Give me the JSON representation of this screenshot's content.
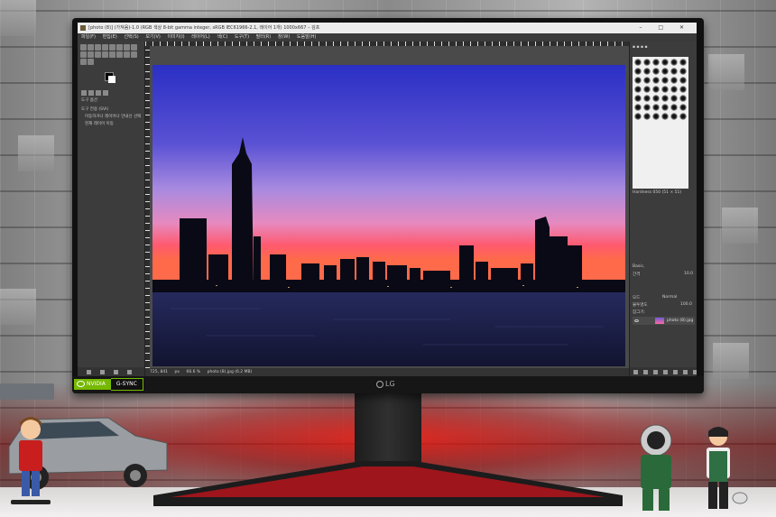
{
  "window": {
    "title": "[photo (8)] (가져옴)-1.0 (RGB 색상 8-bit gamma integer, sRGB IEC61966-2.1, 레이어 1개) 1000x667 – 김프",
    "controls": "– □ ✕"
  },
  "menubar": [
    "파일(F)",
    "편집(E)",
    "선택(S)",
    "보기(V)",
    "이미지(I)",
    "레이어(L)",
    "색(C)",
    "도구(T)",
    "필터(R)",
    "창(W)",
    "도움말(H)"
  ],
  "toolbox": {
    "tab_label": "도구 옵션",
    "group_title": "도구 전용 (SVI)",
    "option1": "이동하거나 레이어나 안내선 선택",
    "option2": "현재 레이어 이동"
  },
  "statusbar": {
    "coords": "725, 841",
    "unit": "px",
    "zoom": "66.6 %",
    "file": "photo (8).jpg (6.2 MB)"
  },
  "dock": {
    "brushes_label": "Hardness 050 (51 × 51)",
    "basic_label": "Basic,",
    "spacing_label": "간격",
    "spacing_value": "10.0",
    "mode_label": "모드",
    "mode_value": "Normal",
    "opacity_label": "불투명도",
    "opacity_value": "100.0",
    "lock_label": "잠그기:",
    "layer_name": "photo (8).jpg"
  },
  "monitor": {
    "brand": "LG",
    "badge_nvidia": "NVIDIA",
    "badge_gsync": "G-SYNC"
  },
  "colors": {
    "sky_top": "#2d32c8",
    "sky_mid": "#8a6ad8",
    "sky_glow": "#ff5a6e",
    "water": "#1a1d4a",
    "gimp_bg": "#3c3c3c",
    "nvidia_green": "#76b900"
  }
}
